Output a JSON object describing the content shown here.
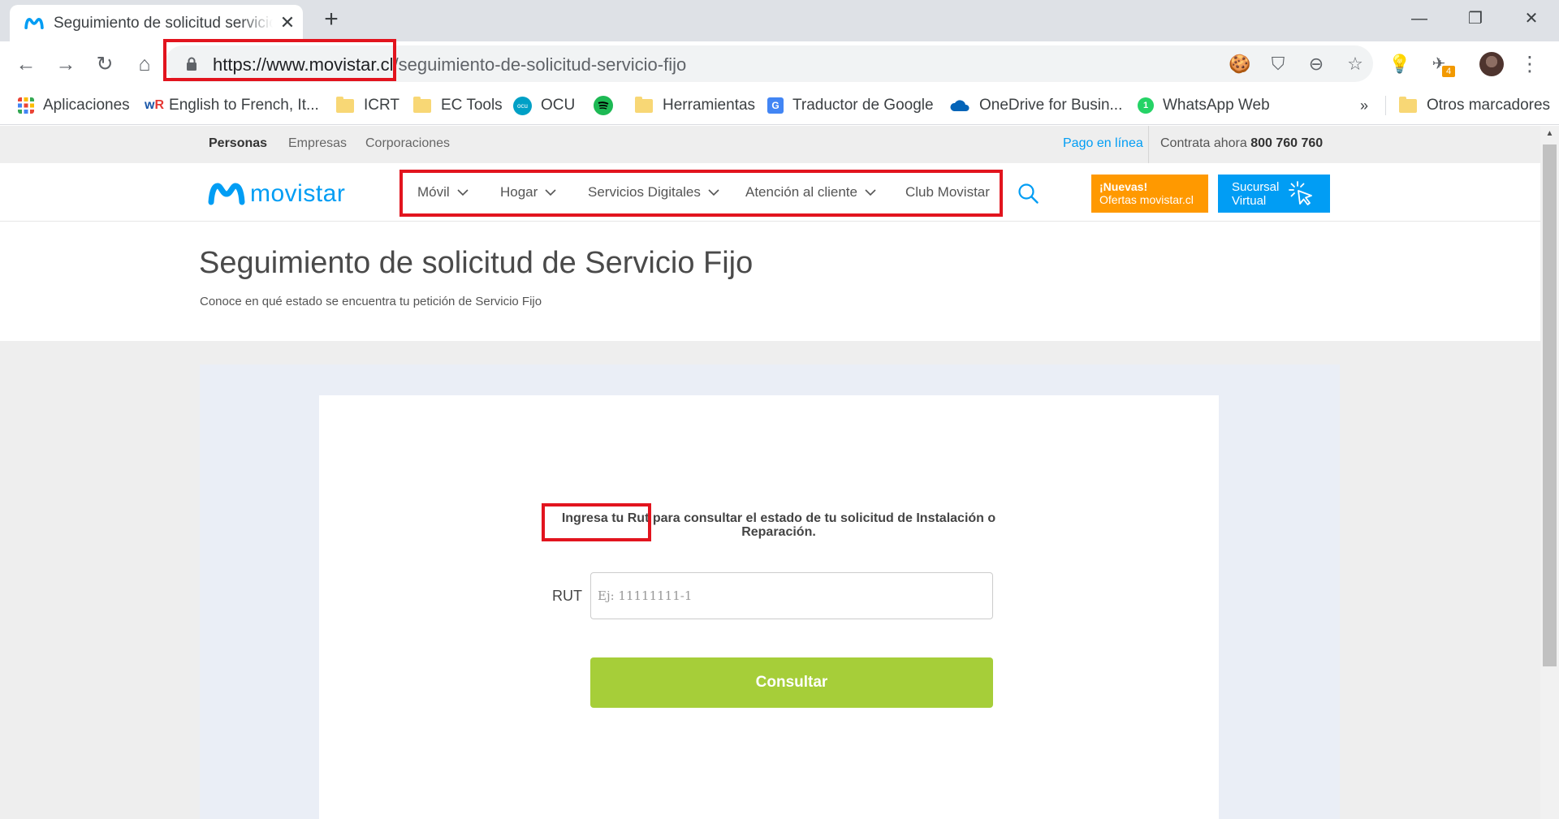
{
  "browser": {
    "tab_title": "Seguimiento de solicitud servicio fijo",
    "url_host": "https://www.movistar.cl",
    "url_path": "/seguimiento-de-solicitud-servicio-fijo",
    "extension_badge": "4",
    "bookmarks": [
      {
        "label": "Aplicaciones",
        "icon": "apps-grid-icon"
      },
      {
        "label": "English to French, It...",
        "icon": "wordreference-icon"
      },
      {
        "label": "ICRT",
        "icon": "folder-icon"
      },
      {
        "label": "EC Tools",
        "icon": "folder-icon"
      },
      {
        "label": "OCU",
        "icon": "ocu-icon"
      },
      {
        "label": "",
        "icon": "spotify-icon"
      },
      {
        "label": "Herramientas",
        "icon": "folder-icon"
      },
      {
        "label": "Traductor de Google",
        "icon": "google-translate-icon"
      },
      {
        "label": "OneDrive for Busin...",
        "icon": "onedrive-icon"
      },
      {
        "label": "WhatsApp Web",
        "icon": "whatsapp-icon"
      }
    ],
    "bookmarks_overflow": "»",
    "other_bookmarks": "Otros marcadores"
  },
  "site": {
    "segments": [
      "Personas",
      "Empresas",
      "Corporaciones"
    ],
    "pago_link": "Pago en línea",
    "contrata_label": "Contrata ahora",
    "contrata_phone": "800 760 760",
    "logo_text": "movistar",
    "menu": [
      "Móvil",
      "Hogar",
      "Servicios Digitales",
      "Atención al cliente",
      "Club Movistar"
    ],
    "ofertas_line1": "¡Nuevas!",
    "ofertas_line2": "Ofertas movistar.cl",
    "sucursal_line1": "Sucursal",
    "sucursal_line2": "Virtual"
  },
  "page": {
    "title": "Seguimiento de solicitud de Servicio Fijo",
    "subtitle": "Conoce en qué estado se encuentra tu petición de Servicio Fijo",
    "instruction": "Ingresa tu Rut para consultar el estado de tu solicitud de Instalación o Reparación.",
    "rut_label": "RUT",
    "rut_placeholder": "Ej: 11111111-1",
    "rut_value": "",
    "submit_label": "Consultar"
  },
  "colors": {
    "movistar_blue": "#019df4",
    "ofertas_orange": "#ff9900",
    "consultar_green": "#a6ce39",
    "annotation_red": "#e2141e"
  }
}
